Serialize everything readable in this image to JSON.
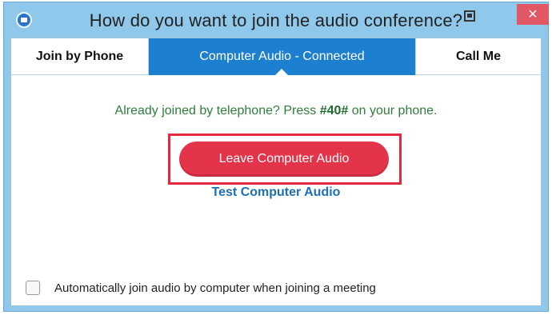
{
  "window": {
    "title": "How do you want to join the audio conference?",
    "close_label": "×"
  },
  "tabs": [
    {
      "label": "Join by Phone"
    },
    {
      "label": "Computer Audio - Connected"
    },
    {
      "label": "Call Me"
    }
  ],
  "main": {
    "info_prefix": "Already joined by telephone? Press ",
    "info_code": "#40#",
    "info_suffix": " on your phone.",
    "leave_button_label": "Leave Computer Audio",
    "test_link_label": "Test Computer Audio"
  },
  "footer": {
    "auto_join_label": "Automatically join audio by computer when joining a meeting",
    "auto_join_checked": false
  },
  "colors": {
    "titlebar": "#8fc8ea",
    "active_tab": "#1d7fcf",
    "leave_button": "#e4344a",
    "highlight": "#e4283f",
    "info_text": "#2f7d3c",
    "link": "#1e6fb5"
  }
}
